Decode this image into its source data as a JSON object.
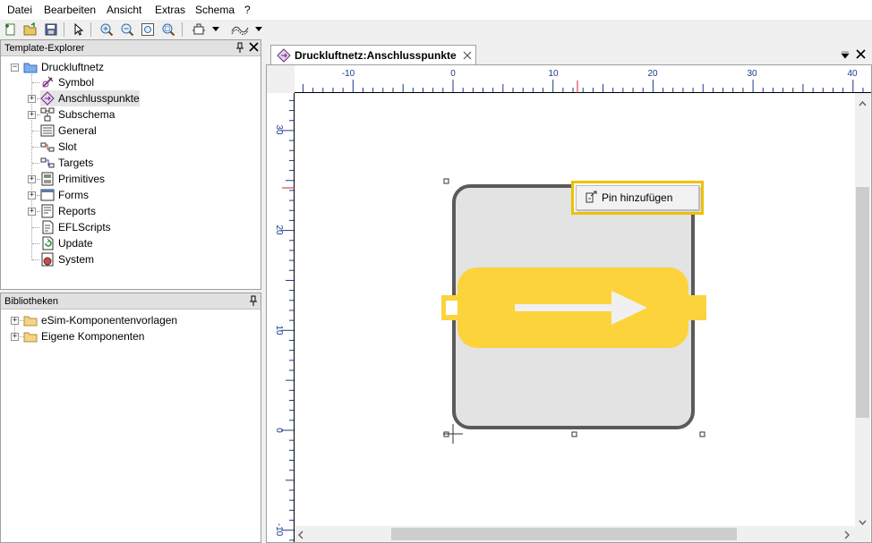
{
  "menu": [
    "Datei",
    "Bearbeiten",
    "Ansicht",
    "Extras",
    "Schema",
    "?"
  ],
  "toolbar_icons": [
    "new-file-icon",
    "open-folder-icon",
    "save-icon",
    "pointer-icon",
    "zoom-in-icon",
    "zoom-out-icon",
    "zoom-fit-icon",
    "zoom-window-icon",
    "component-icon",
    "connection-icon"
  ],
  "explorer": {
    "title": "Template-Explorer",
    "root": "Druckluftnetz",
    "items": [
      {
        "label": "Symbol",
        "expandable": false
      },
      {
        "label": "Anschlusspunkte",
        "expandable": true
      },
      {
        "label": "Subschema",
        "expandable": true
      },
      {
        "label": "General",
        "expandable": false
      },
      {
        "label": "Slot",
        "expandable": false
      },
      {
        "label": "Targets",
        "expandable": false
      },
      {
        "label": "Primitives",
        "expandable": true
      },
      {
        "label": "Forms",
        "expandable": true
      },
      {
        "label": "Reports",
        "expandable": true
      },
      {
        "label": "EFLScripts",
        "expandable": false
      },
      {
        "label": "Update",
        "expandable": false
      },
      {
        "label": "System",
        "expandable": false
      }
    ]
  },
  "libraries": {
    "title": "Bibliotheken",
    "items": [
      "eSim-Komponentenvorlagen",
      "Eigene Komponenten"
    ]
  },
  "document": {
    "tab_title": "Druckluftnetz:Anschlusspunkte",
    "context_menu_item": "Pin hinzufügen"
  },
  "ruler": {
    "h_labels": [
      "-10",
      "0",
      "10",
      "20",
      "30",
      "40"
    ],
    "v_labels": [
      "30",
      "20",
      "10",
      "0",
      "-10"
    ]
  },
  "colors": {
    "symbol_fill": "#fcd33a",
    "frame": "#5a5a5a",
    "frame_fill": "#e3e3e3",
    "highlight": "#f0c000"
  }
}
